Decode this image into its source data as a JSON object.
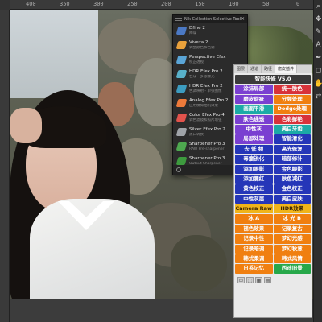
{
  "ruler": {
    "marks": [
      "400",
      "350",
      "300",
      "250",
      "200",
      "150",
      "100",
      "50",
      "0"
    ]
  },
  "toolbar_right": {
    "icons": [
      "zoom-icon",
      "move-icon",
      "brush-icon",
      "type-icon",
      "pen-icon",
      "shape-icon",
      "hand-icon",
      "swap-icon"
    ],
    "glyphs": [
      "⌕",
      "✥",
      "✎",
      "A",
      "✒",
      "◻",
      "✋",
      "⇄"
    ]
  },
  "nik": {
    "title": "Nik Collection Selective Tool",
    "close": "×",
    "items": [
      {
        "name": "Dfine 2",
        "sub": "降噪",
        "color": "#4b79c4"
      },
      {
        "name": "Viveza 2",
        "sub": "调整颜色和色调",
        "color": "#e9a13b"
      },
      {
        "name": "Perspective Efex",
        "sub": "校正透视",
        "color": "#5aa5d6"
      },
      {
        "name": "HDR Efex Pro 2",
        "sub": "合成 - 多张曝光",
        "color": "#58b0c8"
      },
      {
        "name": "HDR Efex Pro 2",
        "sub": "色调映射 - 单张图像",
        "color": "#3c9cc0"
      },
      {
        "name": "Analog Efex Pro 2",
        "sub": "应用模拟相机效果",
        "color": "#ed7a3a"
      },
      {
        "name": "Color Efex Pro 4",
        "sub": "调色滤镜和照片增强",
        "color": "#e2534c"
      },
      {
        "name": "Silver Efex Pro 2",
        "sub": "黑白转换",
        "color": "#9fa3a8"
      },
      {
        "name": "Sharpener Pro 3",
        "sub": "RAW Pre-sharpener",
        "color": "#4ea84f"
      },
      {
        "name": "Sharpener Pro 3",
        "sub": "Output Sharpener",
        "color": "#3d9a3e"
      }
    ]
  },
  "cn_panel": {
    "tabs": [
      "图层",
      "通道",
      "路径",
      "磨皮插件"
    ],
    "buttons": [
      {
        "label": "智能快修 V5.0",
        "color": "c-dark",
        "wide": true
      },
      {
        "label": "涂抹局部",
        "color": "c-purple"
      },
      {
        "label": "统一肤色",
        "color": "c-red"
      },
      {
        "label": "磨皮瑕疵",
        "color": "c-purple"
      },
      {
        "label": "分频处理",
        "color": "c-orange"
      },
      {
        "label": "画面平滑",
        "color": "c-teal"
      },
      {
        "label": "Dodge处理",
        "color": "c-orange"
      },
      {
        "label": "肤色通透",
        "color": "c-purple"
      },
      {
        "label": "色彩鲜艳",
        "color": "c-red"
      },
      {
        "label": "中性灰",
        "color": "c-purple"
      },
      {
        "label": "美白牙齿",
        "color": "c-teal"
      },
      {
        "label": "局部处理",
        "color": "c-purple"
      },
      {
        "label": "智能清化",
        "color": "c-navy"
      },
      {
        "label": "去 低 频",
        "color": "c-navy"
      },
      {
        "label": "高光修复",
        "color": "c-navy"
      },
      {
        "label": "毒瘤锐化",
        "color": "c-navy"
      },
      {
        "label": "暗部修补",
        "color": "c-navy"
      },
      {
        "label": "添加眼影",
        "color": "c-navy"
      },
      {
        "label": "金色眼影",
        "color": "c-navy"
      },
      {
        "label": "添加腮红",
        "color": "c-navy"
      },
      {
        "label": "肤色减红",
        "color": "c-navy"
      },
      {
        "label": "黄色校正",
        "color": "c-navy"
      },
      {
        "label": "金色校正",
        "color": "c-navy"
      },
      {
        "label": "中性灰层",
        "color": "c-navy"
      },
      {
        "label": "美白皮肤",
        "color": "c-navy"
      },
      {
        "label": "Camera Raw",
        "color": "c-gold"
      },
      {
        "label": "HDR效果",
        "color": "c-gold"
      },
      {
        "label": "冰 A",
        "color": "c-orange"
      },
      {
        "label": "冰 光 B",
        "color": "c-orange"
      },
      {
        "label": "褪色效果",
        "color": "c-orange"
      },
      {
        "label": "记录复古",
        "color": "c-orange"
      },
      {
        "label": "记录中性",
        "color": "c-orange"
      },
      {
        "label": "梦幻光感",
        "color": "c-orange"
      },
      {
        "label": "记录暗调",
        "color": "c-orange"
      },
      {
        "label": "梦幻秋意",
        "color": "c-orange"
      },
      {
        "label": "韩式柔调",
        "color": "c-orange"
      },
      {
        "label": "韩式风情",
        "color": "c-orange"
      },
      {
        "label": "日系记忆",
        "color": "c-orange"
      },
      {
        "label": "西迪旧景",
        "color": "c-green"
      }
    ],
    "bottom_icons": [
      "▭",
      "⬚",
      "▦",
      "▤"
    ]
  }
}
